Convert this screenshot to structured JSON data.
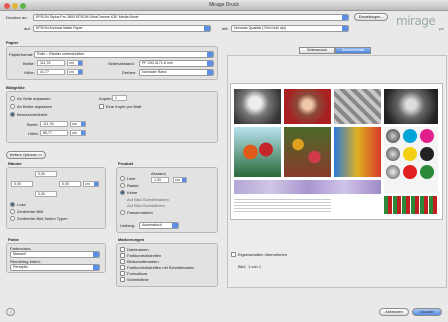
{
  "window": {
    "title": "Mirage Druck"
  },
  "top": {
    "printer_label": "Drucken an:",
    "printer_value": "EPSON Stylus Pro 3800 EPSON UltraChrome K3E Media Mode",
    "printer_btn": "Einstellungen...",
    "media_label": "auf:",
    "media_value": "EPSON Archival Matte Paper",
    "profile_label": "mit:",
    "profile_value": "Normale Qualität (720x1440 dpi)"
  },
  "paper": {
    "section": "Papier",
    "format_label": "Papierformat:",
    "format_value": "Rolle – Ränder unbeschnitten",
    "width_label": "Breite:",
    "width_value": "111,76",
    "width_unit": "cm",
    "height_label": "Höhe:",
    "height_value": "41,77",
    "height_unit": "cm",
    "margin_label": "Seitenabstand:",
    "margin_value": "PF 200-3171.8 mm",
    "rotate_label": "Drehen:",
    "rotate_value": "Normaler Rand"
  },
  "output": {
    "section": "Bildgröße",
    "options": [
      "An Seite anpassen",
      "An Breite anpassen",
      "Benutzerdefiniert"
    ],
    "selected": 2,
    "width_label": "Breite:",
    "width_value": "111,76",
    "width_unit": "cm",
    "height_label": "Höhe:",
    "height_value": "85,77",
    "height_unit": "cm",
    "copies_label": "Kopien:",
    "copies_value": "1",
    "one_copy_label": "Eine Kopie pro Blatt"
  },
  "expand_btn": "Weitere Optionen >>",
  "margins": {
    "section": "Ränder",
    "top": "0,00",
    "left": "0,00",
    "right": "0,00",
    "bottom": "0,00",
    "position_label": "Lage",
    "pos_options": [
      "Lose",
      "Zentrierter Bild",
      "Zentrierter Bild Seiten Typen"
    ],
    "selected": 0
  },
  "product": {
    "section": "Produkt",
    "options": [
      "Linie",
      "Raster",
      "Keine",
      "Passermarken"
    ],
    "sub_labels": [
      "Auf Bild-/Schnittmarken",
      "Auf Bild-/Schnittlinien"
    ],
    "value_label": "Abstand",
    "value": "1,00",
    "value_unit": "cm",
    "selected": 2,
    "orientation_label": "Umfang:",
    "orientation_value": "Automatisch"
  },
  "color": {
    "section": "Farbe",
    "mode_label": "Farbmodus:",
    "mode_value": "Manuell",
    "rendering_label": "Rendering Intent:",
    "rendering_value": "Perzeptiv"
  },
  "marks": {
    "section": "Markierungen",
    "items": [
      "Dateinamen",
      "Farbkontrollstreifen",
      "Bildschnittmarken",
      "Farbkontrollstreifen mit Schnittmarken",
      "Formatkurs",
      "Schneidlinie"
    ]
  },
  "tabs": [
    "Seitenansicht",
    "Druckvorschau"
  ],
  "preview": {
    "active_tab": 1,
    "user_btn_label": "Eigenschaften übernehmen",
    "zoom_label": "Bild:",
    "zoom_value": "1 von 1"
  },
  "buttons": {
    "help": "?",
    "cancel": "Abbrechen",
    "print": "Drucken"
  },
  "logo": {
    "text": "mirage",
    "sub": "pro"
  }
}
